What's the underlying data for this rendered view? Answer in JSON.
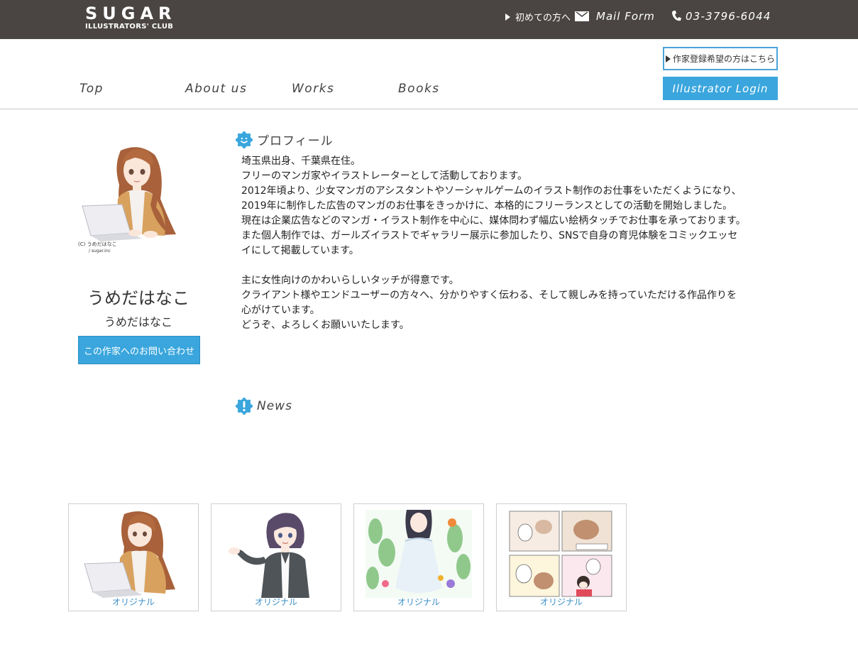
{
  "header": {
    "logo_main": "SUGAR",
    "logo_sub": "ILLUSTRATORS' CLUB",
    "first_time_link": "初めての方へ",
    "mail_link": "Mail Form",
    "phone": "03-3796-6044"
  },
  "nav": {
    "items": [
      {
        "label": "Top"
      },
      {
        "label": "About us"
      },
      {
        "label": "Works"
      },
      {
        "label": "Books"
      }
    ],
    "register_button": "作家登録希望の方はこちら",
    "login_button": "Illustrator Login"
  },
  "artist": {
    "portrait_caption_1": "(C)  うめだはなこ",
    "portrait_caption_2": "/ sugar.inc",
    "name": "うめだはなこ",
    "reading": "うめだはなこ",
    "contact_button": "この作家へのお問い合わせ"
  },
  "profile": {
    "title": "プロフィール",
    "paragraphs": [
      "埼玉県出身、千葉県在住。",
      "フリーのマンガ家やイラストレーターとして活動しております。",
      "2012年頃より、少女マンガのアシスタントやソーシャルゲームのイラスト制作のお仕事をいただくようになり、2019年に制作した広告のマンガのお仕事をきっかけに、本格的にフリーランスとしての活動を開始しました。",
      "現在は企業広告などのマンガ・イラスト制作を中心に、媒体問わず幅広い絵柄タッチでお仕事を承っております。",
      "また個人制作では、ガールズイラストでギャラリー展示に参加したり、SNSで自身の育児体験をコミックエッセイにして掲載しています。",
      "",
      "主に女性向けのかわいらしいタッチが得意です。",
      "クライアント様やエンドユーザーの方々へ、分かりやすく伝わる、そして親しみを持っていただける作品作りを心がけています。",
      "どうぞ、よろしくお願いいたします。"
    ]
  },
  "news": {
    "title": "News"
  },
  "works": [
    {
      "label": "オリジナル"
    },
    {
      "label": "オリジナル"
    },
    {
      "label": "オリジナル"
    },
    {
      "label": "オリジナル"
    }
  ],
  "colors": {
    "topbar": "#4a4543",
    "accent": "#3aa6dd",
    "link": "#3a8fc7"
  }
}
